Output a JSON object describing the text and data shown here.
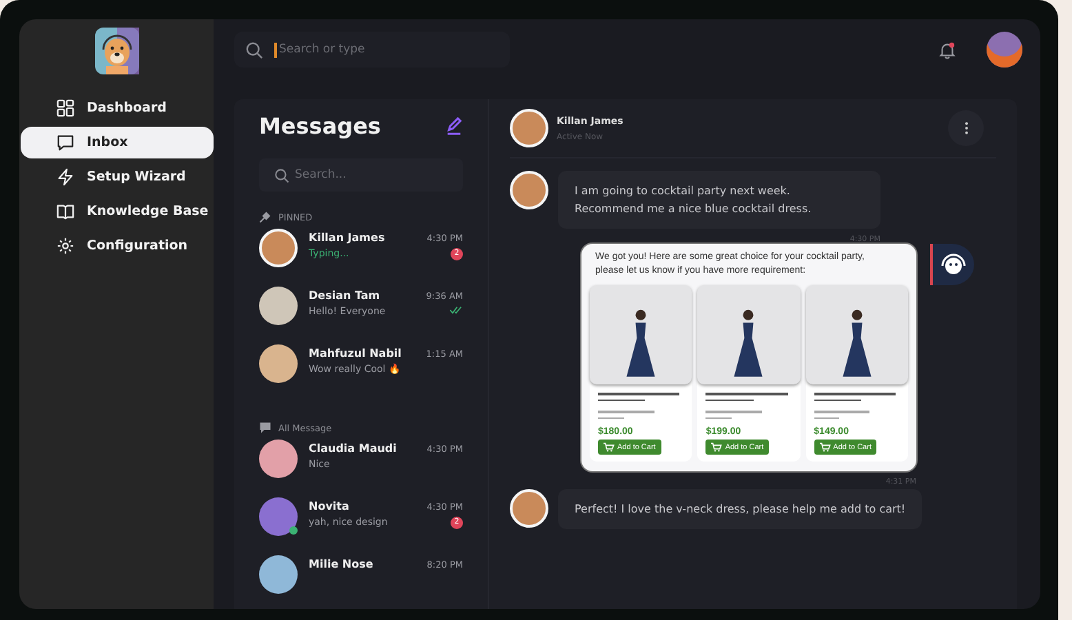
{
  "sidebar": {
    "items": [
      {
        "label": "Dashboard",
        "selected": false
      },
      {
        "label": "Inbox",
        "selected": true
      },
      {
        "label": "Setup Wizard",
        "selected": false
      },
      {
        "label": "Knowledge Base",
        "selected": false
      },
      {
        "label": "Configuration",
        "selected": false
      }
    ]
  },
  "topbar": {
    "search": {
      "placeholder": "Search or type"
    },
    "notifications": true
  },
  "messages_panel": {
    "title": "Messages",
    "search": {
      "placeholder": "Search..."
    },
    "sections": [
      {
        "label": "PINNED",
        "kind": "pinned",
        "conversations": [
          {
            "name": "Killan James",
            "preview": "Typing...",
            "time": "4:30 PM",
            "unread": "2",
            "typing": true,
            "read": false,
            "online": false,
            "selected": true
          },
          {
            "name": "Desian Tam",
            "preview": "Hello! Everyone",
            "time": "9:36 AM",
            "typing": false,
            "read": true,
            "online": false,
            "selected": false
          },
          {
            "name": "Mahfuzul Nabil",
            "preview": "Wow really Cool 🔥",
            "time": "1:15 AM",
            "typing": false,
            "read": false,
            "online": false,
            "selected": false
          }
        ]
      },
      {
        "label": "All Message",
        "kind": "all",
        "conversations": [
          {
            "name": "Claudia Maudi",
            "preview": "Nice",
            "time": "4:30 PM",
            "typing": false,
            "read": false,
            "online": false,
            "selected": false
          },
          {
            "name": "Novita",
            "preview": "yah, nice design",
            "time": "4:30 PM",
            "unread": "2",
            "typing": false,
            "read": false,
            "online": true,
            "selected": false
          },
          {
            "name": "Milie Nose",
            "time": "8:20 PM",
            "typing": false,
            "read": false,
            "online": false,
            "selected": false
          }
        ]
      }
    ]
  },
  "chat": {
    "contact": {
      "name": "Killan James",
      "status": "Active Now"
    },
    "messages": [
      {
        "kind": "user",
        "lines": [
          "I am going to cocktail party next week.",
          "Recommend me a nice blue cocktail dress."
        ],
        "time": "4:30 PM"
      },
      {
        "kind": "bot",
        "lines": [
          "We got you! Here are some great choice for your cocktail party,",
          "please let us know if you have more requirement:"
        ],
        "time": "4:31 PM",
        "products": [
          {
            "price": "$180.00",
            "button": "Add to Cart"
          },
          {
            "price": "$199.00",
            "button": "Add to Cart"
          },
          {
            "price": "$149.00",
            "button": "Add to Cart"
          }
        ]
      },
      {
        "kind": "user",
        "lines": [
          "Perfect! I love the v-neck dress, please help me add to cart!"
        ]
      }
    ]
  }
}
